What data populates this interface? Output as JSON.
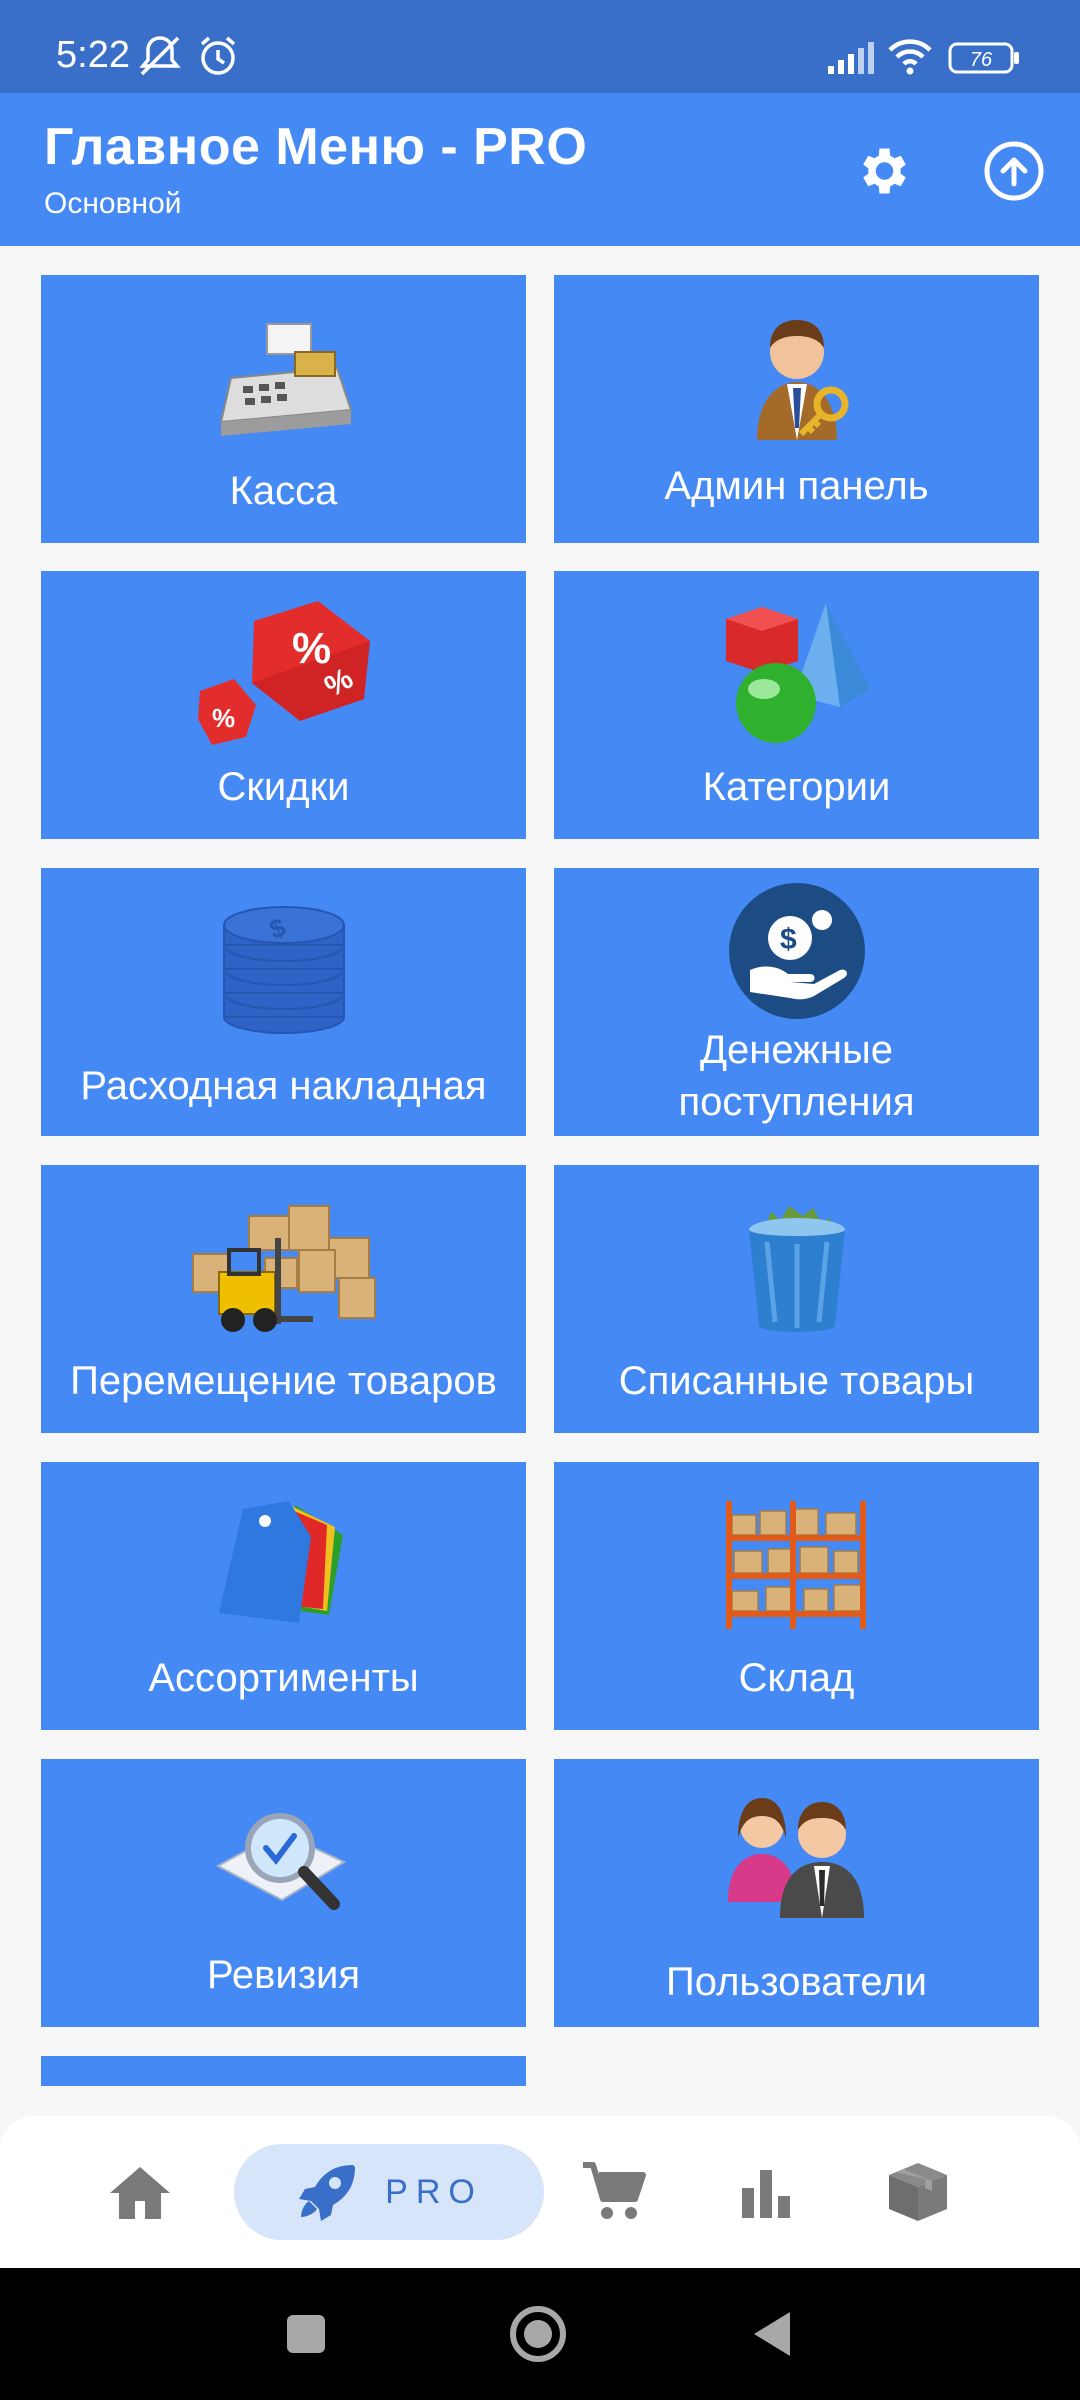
{
  "status_bar": {
    "time": "5:22",
    "battery": "76"
  },
  "app_bar": {
    "title": "Главное Меню - PRO",
    "subtitle": "Основной"
  },
  "tiles": [
    {
      "label": "Касса",
      "icon": "cash-register-icon"
    },
    {
      "label": "Админ панель",
      "icon": "admin-key-icon"
    },
    {
      "label": "Скидки",
      "icon": "discount-dice-icon"
    },
    {
      "label": "Категории",
      "icon": "shapes-icon"
    },
    {
      "label": "Расходная накладная",
      "icon": "coins-stack-icon"
    },
    {
      "label": "Денежные поступления",
      "icon": "money-hand-icon"
    },
    {
      "label": "Перемещение товаров",
      "icon": "forklift-boxes-icon"
    },
    {
      "label": "Списанные товары",
      "icon": "trash-bin-icon"
    },
    {
      "label": "Ассортименты",
      "icon": "price-tags-icon"
    },
    {
      "label": "Склад",
      "icon": "warehouse-shelves-icon"
    },
    {
      "label": "Ревизия",
      "icon": "magnifier-check-icon"
    },
    {
      "label": "Пользователи",
      "icon": "users-icon"
    }
  ],
  "bottom_nav": {
    "pro_label": "PRO",
    "items": [
      "home-icon",
      "rocket-icon",
      "cart-icon",
      "bar-chart-icon",
      "box-icon"
    ]
  },
  "colors": {
    "status_bar": "#3a6fc9",
    "primary": "#4589f5",
    "pill": "#d7e5fb",
    "background": "#f7f7f7"
  }
}
